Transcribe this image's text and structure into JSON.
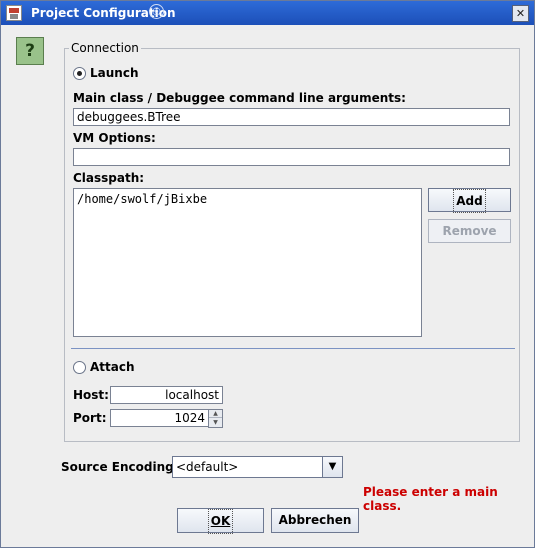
{
  "window": {
    "title": "Project Configuration",
    "close_glyph": "✕",
    "title_deco_glyph": "◎"
  },
  "help": {
    "glyph": "?"
  },
  "connection": {
    "group_label": "Connection",
    "launch": {
      "label": "Launch",
      "selected": true,
      "main_class_label": "Main class / Debuggee command line arguments:",
      "main_class_value": "debuggees.BTree",
      "vm_options_label": "VM Options:",
      "vm_options_value": "",
      "classpath_label": "Classpath:",
      "classpath_items": [
        "/home/swolf/jBixbe"
      ],
      "add_label": "Add",
      "remove_label": "Remove"
    },
    "attach": {
      "label": "Attach",
      "selected": false,
      "host_label": "Host:",
      "host_value": "localhost",
      "port_label": "Port:",
      "port_value": "1024"
    }
  },
  "encoding": {
    "label": "Source Encoding:",
    "value": "<default>"
  },
  "error_message": "Please enter a main class.",
  "buttons": {
    "ok": "OK",
    "cancel": "Abbrechen"
  },
  "colors": {
    "title_bar": "#1c4fb8",
    "error": "#cc0000",
    "help_icon": "#99c28a"
  }
}
